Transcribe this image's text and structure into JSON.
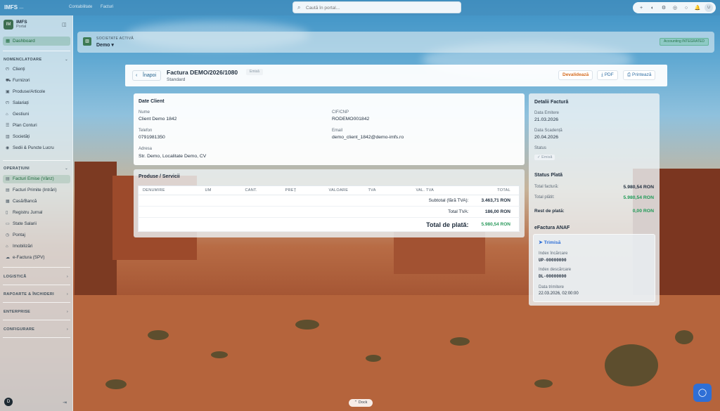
{
  "topbar": {
    "brand": "IMFS",
    "brand_sub": "—",
    "crumbs": [
      "Contabilitate",
      "Facturi"
    ],
    "search_placeholder": "Caută în portal...",
    "tools": [
      "+",
      "◐",
      "⚙",
      "◎",
      "○",
      "🔔"
    ],
    "avatar": "U"
  },
  "sidebar": {
    "logo": "IM",
    "title": "IMFS",
    "subtitle": "Portal",
    "dashboard": "Dashboard",
    "sections": {
      "nomenclatoare": "NOMENCLATOARE",
      "operatiuni": "OPERAȚIUNI",
      "logistica": "LOGISTICĂ",
      "rapoarte": "RAPOARTE & ÎNCHIDERI",
      "enterprise": "ENTERPRISE",
      "configurare": "CONFIGURARE"
    },
    "nomenclatoare_items": [
      "Clienți",
      "Furnizori",
      "Produse/Articole",
      "Salariați",
      "Gestiuni",
      "Plan Conturi",
      "Societăți",
      "Sedii & Puncte Lucru"
    ],
    "operatiuni_items": [
      "Facturi Emise (Vânz)",
      "Facturi Primite (Intrări)",
      "Casă/Bancă",
      "Registru Jurnal",
      "State Salarii",
      "Pontaj",
      "Imobilizări",
      "e-Factura (SPV)"
    ],
    "user_initial": "D"
  },
  "company": {
    "label": "SOCIETATE ACTIVĂ",
    "value": "Demo",
    "badge": "Accounting INTEGRATED"
  },
  "invoice": {
    "back_label": "Înapoi",
    "title": "Factura DEMO/2026/1080",
    "status": "Emisă",
    "subtitle": "Standard",
    "actions": {
      "devalidate": "Devalidează",
      "pdf": "PDF",
      "print": "Printează"
    }
  },
  "client": {
    "title": "Date Client",
    "name_label": "Nume",
    "name": "Client Demo 1842",
    "cif_label": "CIF/CNP",
    "cif": "RODEMO001842",
    "phone_label": "Telefon",
    "phone": "0791981350",
    "email_label": "Email",
    "email": "demo_client_1842@demo-imfs.ro",
    "address_label": "Adresa",
    "address": "Str. Demo, Localitate Demo, CV"
  },
  "products": {
    "title": "Produse / Servicii",
    "columns": [
      "DENUMIRE",
      "UM",
      "CANT.",
      "PREȚ",
      "VALOARE",
      "TVA",
      "VAL. TVA",
      "TOTAL"
    ],
    "subtotal_label": "Subtotal (fără TVA):",
    "subtotal": "3.463,71 RON",
    "vat_label": "Total TVA:",
    "vat": "186,00 RON",
    "grand_label": "Total de plată:",
    "grand": "5.980,54 RON"
  },
  "details": {
    "title": "Detalii Factură",
    "issue_label": "Data Emitere",
    "issue": "21.03.2026",
    "due_label": "Data Scadență",
    "due": "20.04.2026",
    "status_label": "Status",
    "status": "Emisă"
  },
  "payment": {
    "title": "Status Plată",
    "total_label": "Total factură:",
    "total": "5.980,54 RON",
    "paid_label": "Total plătit:",
    "paid": "5.980,54 RON",
    "rest_label": "Rest de plată:",
    "rest": "0,00 RON"
  },
  "efactura": {
    "title": "eFactura ANAF",
    "status": "Trimisă",
    "upload_label": "Index încărcare",
    "upload": "UP-00000000",
    "download_label": "Index descărcare",
    "download": "DL-00000000",
    "sent_label": "Data trimitere",
    "sent": "22.03.2026, 02:00:00"
  },
  "dock": "Dock"
}
